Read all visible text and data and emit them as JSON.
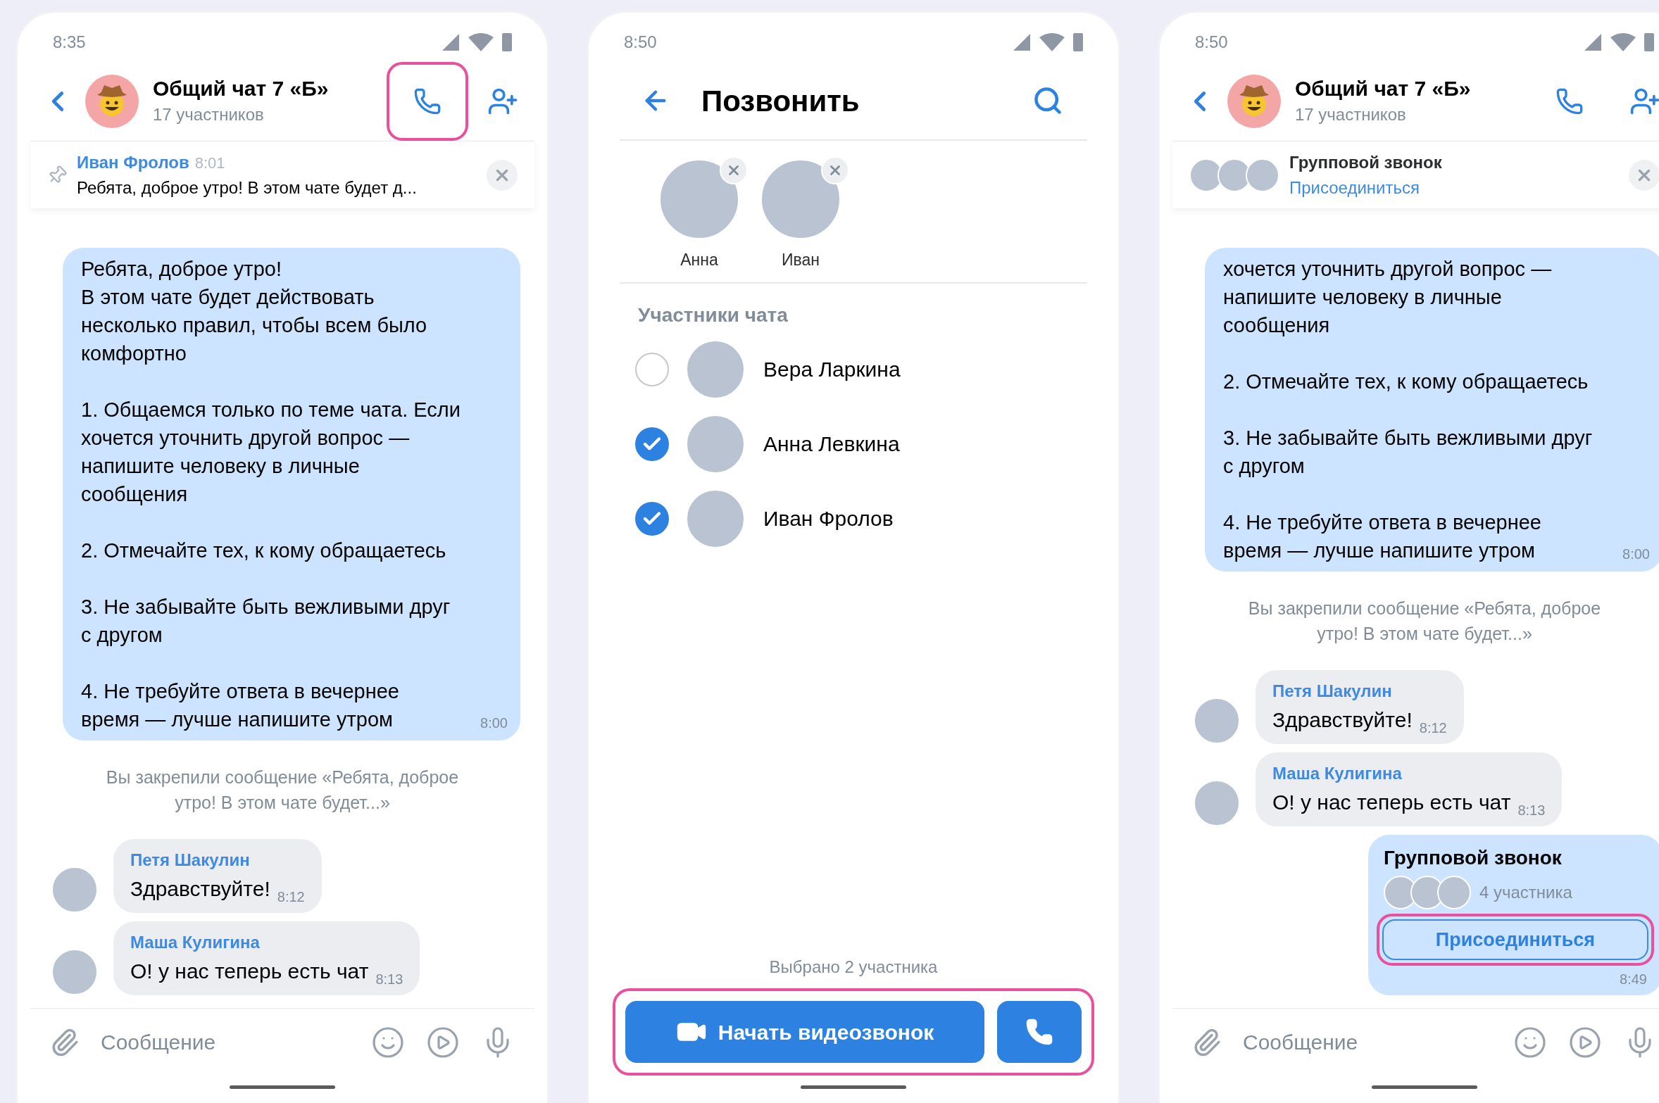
{
  "screens": [
    {
      "kind": "chat",
      "status_time": "8:35",
      "title": "Общий чат 7 «Б»",
      "subtitle": "17 участников",
      "call_highlighted": true,
      "banner": {
        "kind": "pinned",
        "author": "Иван Фролов",
        "time": "8:01",
        "text": "Ребята, доброе утро! В этом чате будет д..."
      },
      "messages": [
        {
          "kind": "outgoing",
          "text": "Ребята, доброе утро!\nВ этом чате будет действовать\nнесколько правил, чтобы всем было\nкомфортно\n\n1. Общаемся только по теме чата. Если\nхочется уточнить другой вопрос —\nнапишите человеку в личные\nсообщения\n\n2. Отмечайте тех, к кому обращаетесь\n\n3. Не забывайте быть вежливыми друг\nс другом\n\n4. Не требуйте ответа в вечернее\nвремя — лучше напишите утром",
          "time": "8:00"
        },
        {
          "kind": "system",
          "text": "Вы закрепили сообщение «Ребята, доброе\nутро! В этом чате будет...»"
        },
        {
          "kind": "incoming",
          "author": "Петя Шакулин",
          "text": "Здравствуйте!",
          "time": "8:12"
        },
        {
          "kind": "incoming",
          "author": "Маша Кулигина",
          "text": "О! у нас теперь есть чат",
          "time": "8:13"
        }
      ],
      "composer": {
        "placeholder": "Сообщение"
      }
    },
    {
      "kind": "call_picker",
      "status_time": "8:50",
      "title": "Позвонить",
      "chips": [
        {
          "name": "Анна"
        },
        {
          "name": "Иван"
        }
      ],
      "section": "Участники чата",
      "contacts": [
        {
          "name": "Вера Ларкина",
          "selected": false
        },
        {
          "name": "Анна Левкина",
          "selected": true
        },
        {
          "name": "Иван Фролов",
          "selected": true
        }
      ],
      "summary": "Выбрано 2 участника",
      "video_button": "Начать видеозвонок",
      "buttons_highlighted": true
    },
    {
      "kind": "chat",
      "status_time": "8:50",
      "title": "Общий чат 7 «Б»",
      "subtitle": "17 участников",
      "call_highlighted": false,
      "banner": {
        "kind": "call",
        "title": "Групповой звонок",
        "action": "Присоединиться"
      },
      "messages": [
        {
          "kind": "outgoing",
          "text": "хочется уточнить другой вопрос —\nнапишите человеку в личные\nсообщения\n\n2. Отмечайте тех, к кому обращаетесь\n\n3. Не забывайте быть вежливыми друг\nс другом\n\n4. Не требуйте ответа в вечернее\nвремя — лучше напишите утром",
          "time": "8:00"
        },
        {
          "kind": "system",
          "text": "Вы закрепили сообщение «Ребята, доброе\nутро! В этом чате будет...»"
        },
        {
          "kind": "incoming",
          "author": "Петя Шакулин",
          "text": "Здравствуйте!",
          "time": "8:12"
        },
        {
          "kind": "incoming",
          "author": "Маша Кулигина",
          "text": "О! у нас теперь есть чат",
          "time": "8:13"
        },
        {
          "kind": "call",
          "title": "Групповой звонок",
          "count": "4 участника",
          "action": "Присоединиться",
          "time": "8:49",
          "highlighted": true
        }
      ],
      "composer": {
        "placeholder": "Сообщение"
      }
    }
  ]
}
